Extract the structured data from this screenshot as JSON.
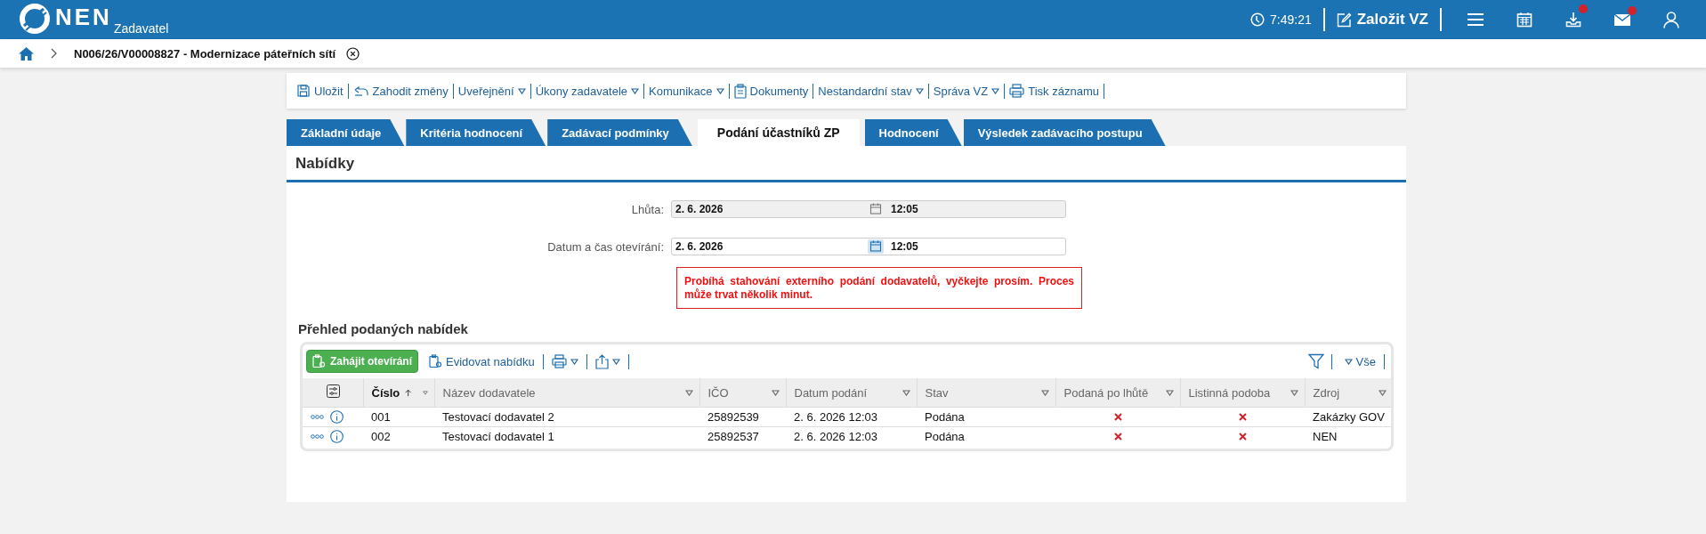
{
  "header": {
    "logo": "NEN",
    "subtitle": "Zadavatel",
    "time": "7:49:21",
    "create_label": "Založit VZ",
    "actions": [
      {
        "kind": "menu",
        "badge": false
      },
      {
        "kind": "calendar",
        "badge": false
      },
      {
        "kind": "download",
        "badge": true
      },
      {
        "kind": "mail",
        "badge": true
      },
      {
        "kind": "user",
        "badge": false
      }
    ]
  },
  "breadcrumb": {
    "title": "N006/26/V00008827 - Modernizace páteřních sítí"
  },
  "toolbar": {
    "items": [
      {
        "label": "Uložit",
        "dropdown": false
      },
      {
        "label": "Zahodit změny",
        "dropdown": false
      },
      {
        "label": "Uveřejnění",
        "dropdown": true
      },
      {
        "label": "Úkony zadavatele",
        "dropdown": true
      },
      {
        "label": "Komunikace",
        "dropdown": true
      },
      {
        "label": "Dokumenty",
        "dropdown": false
      },
      {
        "label": "Nestandardní stav",
        "dropdown": true
      },
      {
        "label": "Správa VZ",
        "dropdown": true
      },
      {
        "label": "Tisk záznamu",
        "dropdown": false
      }
    ]
  },
  "tabs": [
    {
      "label": "Základní údaje",
      "selected": false
    },
    {
      "label": "Kritéria hodnocení",
      "selected": false
    },
    {
      "label": "Zadávací podmínky",
      "selected": false
    },
    {
      "label": "Podání účastníků ZP",
      "selected": true
    },
    {
      "label": "Hodnocení",
      "selected": false
    },
    {
      "label": "Výsledek zadávacího postupu",
      "selected": false
    }
  ],
  "section": {
    "title": "Nabídky",
    "fields": [
      {
        "label": "Lhůta:",
        "date": "2. 6. 2026",
        "time": "12:05",
        "disabled": true
      },
      {
        "label": "Datum a čas otevírání:",
        "date": "2. 6. 2026",
        "time": "12:05",
        "disabled": false
      }
    ],
    "alert": "Probíhá stahování externího podání dodavatelů, vyčkejte prosím. Proces může trvat několik minut."
  },
  "offers": {
    "title": "Přehled podaných nabídek",
    "primary_button": "Zahájit otevírání",
    "secondary_button": "Evidovat nabídku",
    "filter_label": "Vše",
    "columns": [
      {
        "label": "Číslo",
        "sorted": true
      },
      {
        "label": "Název dodavatele",
        "sorted": false
      },
      {
        "label": "IČO",
        "sorted": false
      },
      {
        "label": "Datum podání",
        "sorted": false
      },
      {
        "label": "Stav",
        "sorted": false
      },
      {
        "label": "Podaná po lhůtě",
        "sorted": false
      },
      {
        "label": "Listinná podoba",
        "sorted": false
      },
      {
        "label": "Zdroj",
        "sorted": false
      }
    ],
    "rows": [
      {
        "number": "001",
        "supplier": "Testovací dodavatel 2",
        "ico": "25892539",
        "date": "2. 6. 2026 12:03",
        "status": "Podána",
        "late": false,
        "paper": false,
        "source": "Zakázky GOV"
      },
      {
        "number": "002",
        "supplier": "Testovací dodavatel 1",
        "ico": "25892537",
        "date": "2. 6. 2026 12:03",
        "status": "Podána",
        "late": false,
        "paper": false,
        "source": "NEN"
      }
    ]
  }
}
